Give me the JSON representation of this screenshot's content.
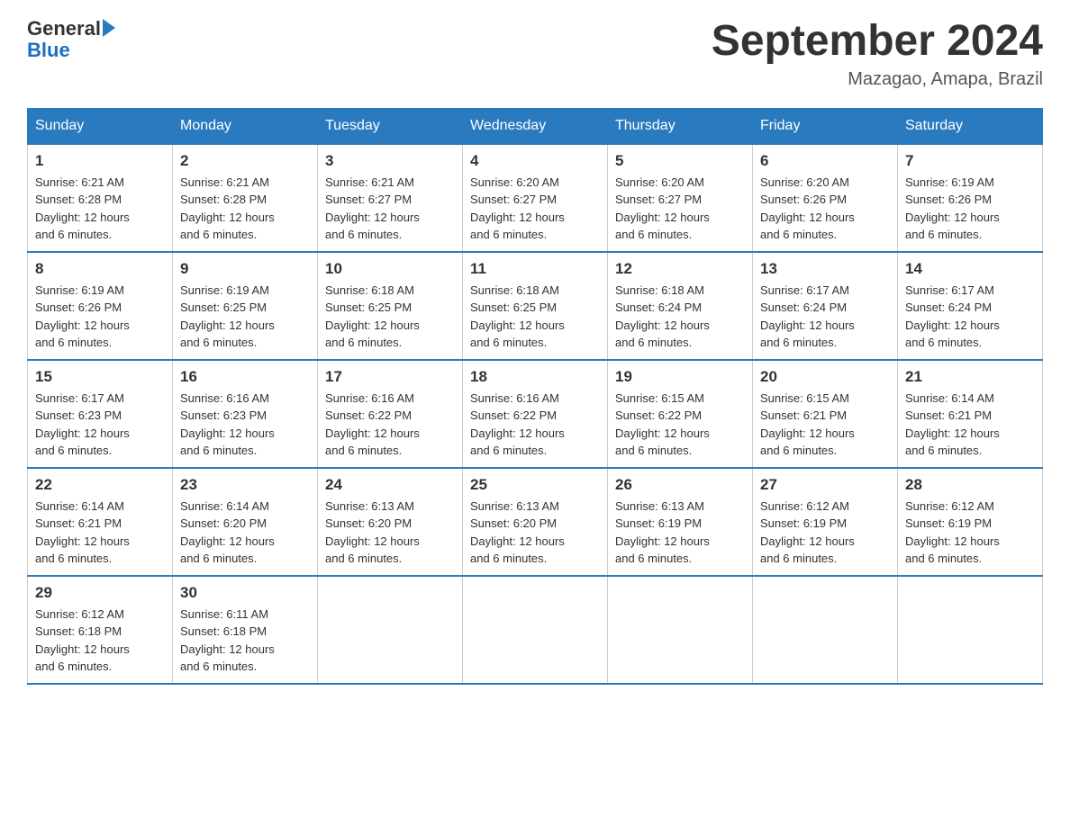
{
  "header": {
    "logo_general": "General",
    "logo_blue": "Blue",
    "month_title": "September 2024",
    "location": "Mazagao, Amapa, Brazil"
  },
  "days_of_week": [
    "Sunday",
    "Monday",
    "Tuesday",
    "Wednesday",
    "Thursday",
    "Friday",
    "Saturday"
  ],
  "weeks": [
    [
      {
        "day": "1",
        "sunrise": "6:21 AM",
        "sunset": "6:28 PM",
        "daylight": "12 hours and 6 minutes."
      },
      {
        "day": "2",
        "sunrise": "6:21 AM",
        "sunset": "6:28 PM",
        "daylight": "12 hours and 6 minutes."
      },
      {
        "day": "3",
        "sunrise": "6:21 AM",
        "sunset": "6:27 PM",
        "daylight": "12 hours and 6 minutes."
      },
      {
        "day": "4",
        "sunrise": "6:20 AM",
        "sunset": "6:27 PM",
        "daylight": "12 hours and 6 minutes."
      },
      {
        "day": "5",
        "sunrise": "6:20 AM",
        "sunset": "6:27 PM",
        "daylight": "12 hours and 6 minutes."
      },
      {
        "day": "6",
        "sunrise": "6:20 AM",
        "sunset": "6:26 PM",
        "daylight": "12 hours and 6 minutes."
      },
      {
        "day": "7",
        "sunrise": "6:19 AM",
        "sunset": "6:26 PM",
        "daylight": "12 hours and 6 minutes."
      }
    ],
    [
      {
        "day": "8",
        "sunrise": "6:19 AM",
        "sunset": "6:26 PM",
        "daylight": "12 hours and 6 minutes."
      },
      {
        "day": "9",
        "sunrise": "6:19 AM",
        "sunset": "6:25 PM",
        "daylight": "12 hours and 6 minutes."
      },
      {
        "day": "10",
        "sunrise": "6:18 AM",
        "sunset": "6:25 PM",
        "daylight": "12 hours and 6 minutes."
      },
      {
        "day": "11",
        "sunrise": "6:18 AM",
        "sunset": "6:25 PM",
        "daylight": "12 hours and 6 minutes."
      },
      {
        "day": "12",
        "sunrise": "6:18 AM",
        "sunset": "6:24 PM",
        "daylight": "12 hours and 6 minutes."
      },
      {
        "day": "13",
        "sunrise": "6:17 AM",
        "sunset": "6:24 PM",
        "daylight": "12 hours and 6 minutes."
      },
      {
        "day": "14",
        "sunrise": "6:17 AM",
        "sunset": "6:24 PM",
        "daylight": "12 hours and 6 minutes."
      }
    ],
    [
      {
        "day": "15",
        "sunrise": "6:17 AM",
        "sunset": "6:23 PM",
        "daylight": "12 hours and 6 minutes."
      },
      {
        "day": "16",
        "sunrise": "6:16 AM",
        "sunset": "6:23 PM",
        "daylight": "12 hours and 6 minutes."
      },
      {
        "day": "17",
        "sunrise": "6:16 AM",
        "sunset": "6:22 PM",
        "daylight": "12 hours and 6 minutes."
      },
      {
        "day": "18",
        "sunrise": "6:16 AM",
        "sunset": "6:22 PM",
        "daylight": "12 hours and 6 minutes."
      },
      {
        "day": "19",
        "sunrise": "6:15 AM",
        "sunset": "6:22 PM",
        "daylight": "12 hours and 6 minutes."
      },
      {
        "day": "20",
        "sunrise": "6:15 AM",
        "sunset": "6:21 PM",
        "daylight": "12 hours and 6 minutes."
      },
      {
        "day": "21",
        "sunrise": "6:14 AM",
        "sunset": "6:21 PM",
        "daylight": "12 hours and 6 minutes."
      }
    ],
    [
      {
        "day": "22",
        "sunrise": "6:14 AM",
        "sunset": "6:21 PM",
        "daylight": "12 hours and 6 minutes."
      },
      {
        "day": "23",
        "sunrise": "6:14 AM",
        "sunset": "6:20 PM",
        "daylight": "12 hours and 6 minutes."
      },
      {
        "day": "24",
        "sunrise": "6:13 AM",
        "sunset": "6:20 PM",
        "daylight": "12 hours and 6 minutes."
      },
      {
        "day": "25",
        "sunrise": "6:13 AM",
        "sunset": "6:20 PM",
        "daylight": "12 hours and 6 minutes."
      },
      {
        "day": "26",
        "sunrise": "6:13 AM",
        "sunset": "6:19 PM",
        "daylight": "12 hours and 6 minutes."
      },
      {
        "day": "27",
        "sunrise": "6:12 AM",
        "sunset": "6:19 PM",
        "daylight": "12 hours and 6 minutes."
      },
      {
        "day": "28",
        "sunrise": "6:12 AM",
        "sunset": "6:19 PM",
        "daylight": "12 hours and 6 minutes."
      }
    ],
    [
      {
        "day": "29",
        "sunrise": "6:12 AM",
        "sunset": "6:18 PM",
        "daylight": "12 hours and 6 minutes."
      },
      {
        "day": "30",
        "sunrise": "6:11 AM",
        "sunset": "6:18 PM",
        "daylight": "12 hours and 6 minutes."
      },
      null,
      null,
      null,
      null,
      null
    ]
  ],
  "labels": {
    "sunrise": "Sunrise:",
    "sunset": "Sunset:",
    "daylight": "Daylight:"
  }
}
